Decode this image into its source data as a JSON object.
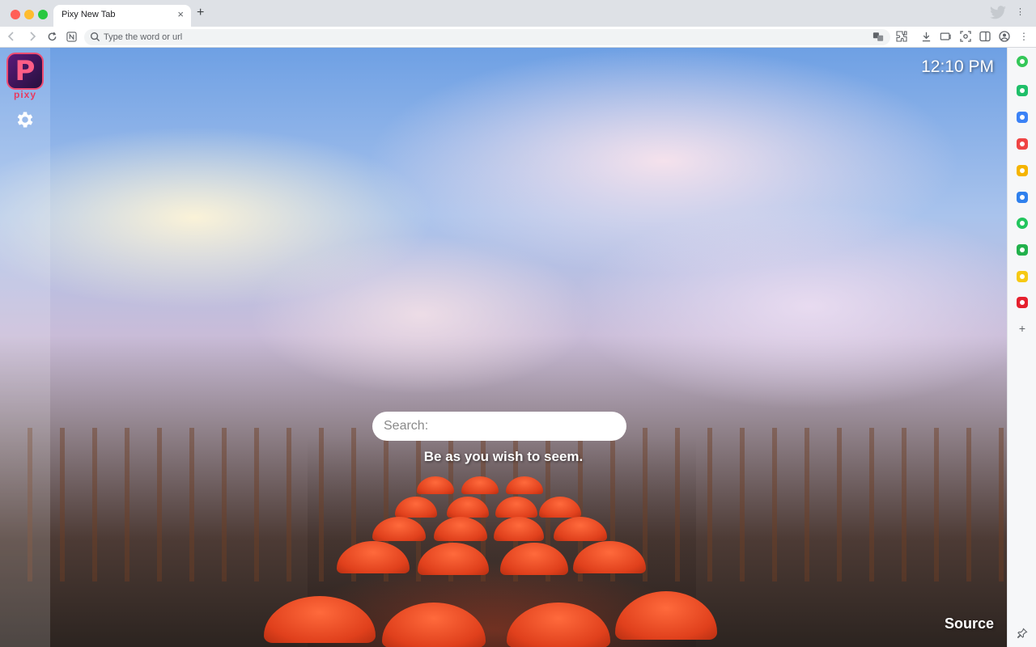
{
  "browser": {
    "tab_title": "Pixy New Tab",
    "tab_close": "×",
    "new_tab": "+",
    "address_placeholder": "Type the word or url",
    "menu_glyph": "⋮"
  },
  "sidebar_left": {
    "logo_letter": "P",
    "logo_word": "pixy"
  },
  "main": {
    "clock": "12:10 PM",
    "search_placeholder": "Search:",
    "quote": "Be as you wish to seem.",
    "source_link": "Source"
  },
  "sidebar_right": {
    "apps": [
      {
        "name": "chatgpt-app-icon",
        "color": "#34c759"
      },
      {
        "name": "bell-app-icon",
        "color": "#1fbf6a"
      },
      {
        "name": "calendar-app-icon",
        "color": "#3b82f6"
      },
      {
        "name": "pocket-app-icon",
        "color": "#ef4444"
      },
      {
        "name": "star-app-icon",
        "color": "#f5b400"
      },
      {
        "name": "google-translate-app-icon",
        "color": "#2f80ed"
      },
      {
        "name": "play-app-icon",
        "color": "#22c55e"
      },
      {
        "name": "chat-app-icon",
        "color": "#22b14c"
      },
      {
        "name": "notes-app-icon",
        "color": "#f6c915"
      },
      {
        "name": "lego-app-icon",
        "color": "#e5202e"
      }
    ],
    "add_label": "+"
  },
  "colors": {
    "accent": "#ef4d72",
    "chrome_bg": "#dee1e6"
  }
}
